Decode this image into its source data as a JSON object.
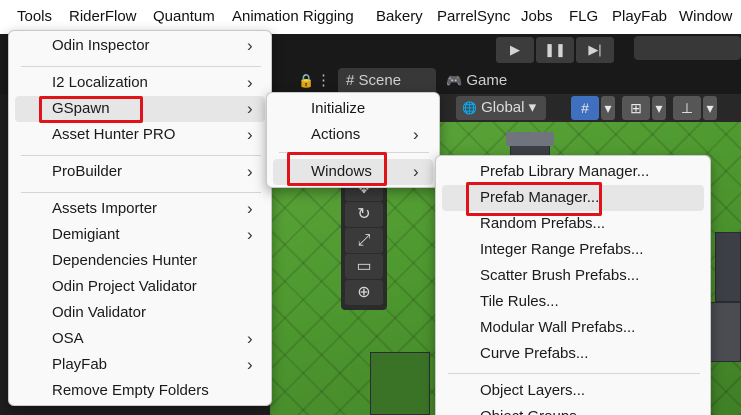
{
  "menubar": {
    "items": [
      "Tools",
      "RiderFlow",
      "Quantum",
      "Animation Rigging",
      "Bakery",
      "ParrelSync",
      "Jobs",
      "FLG",
      "PlayFab",
      "Window"
    ]
  },
  "toolbar": {
    "play_icon": "▶",
    "pause_icon": "❚❚",
    "step_icon": "▶|"
  },
  "tabs": {
    "scene_icon": "#",
    "scene_label": "Scene",
    "game_icon": "🎮",
    "game_label": "Game",
    "lock_icon": "🔒",
    "more_icon": "⋮"
  },
  "scene_toolbar": {
    "global_label": "Global",
    "global_icon": "🌐",
    "dropdown_icon": "▾"
  },
  "tools_menu": {
    "items": [
      {
        "label": "Odin Inspector",
        "submenu": true
      },
      {
        "label": "I2 Localization",
        "submenu": true
      },
      {
        "label": "GSpawn",
        "submenu": true
      },
      {
        "label": "Asset Hunter PRO",
        "submenu": true
      },
      {
        "label": "ProBuilder",
        "submenu": true
      },
      {
        "label": "Assets Importer",
        "submenu": true
      },
      {
        "label": "Demigiant",
        "submenu": true
      },
      {
        "label": "Dependencies Hunter",
        "submenu": false
      },
      {
        "label": "Odin Project Validator",
        "submenu": false
      },
      {
        "label": "Odin Validator",
        "submenu": false
      },
      {
        "label": "OSA",
        "submenu": true
      },
      {
        "label": "PlayFab",
        "submenu": true
      },
      {
        "label": "Remove Empty Folders",
        "submenu": false
      }
    ]
  },
  "gspawn_menu": {
    "items": [
      {
        "label": "Initialize",
        "submenu": false
      },
      {
        "label": "Actions",
        "submenu": true
      },
      {
        "label": "Windows",
        "submenu": true
      }
    ]
  },
  "windows_menu": {
    "items": [
      {
        "label": "Prefab Library Manager..."
      },
      {
        "label": "Prefab Manager..."
      },
      {
        "label": "Random Prefabs..."
      },
      {
        "label": "Integer Range Prefabs..."
      },
      {
        "label": "Scatter Brush Prefabs..."
      },
      {
        "label": "Tile Rules..."
      },
      {
        "label": "Modular Wall Prefabs..."
      },
      {
        "label": "Curve Prefabs..."
      },
      {
        "label": "Object Layers..."
      },
      {
        "label": "Object Groups..."
      }
    ]
  },
  "submenu_arrow": "›",
  "highlight_color": "#e0131a"
}
